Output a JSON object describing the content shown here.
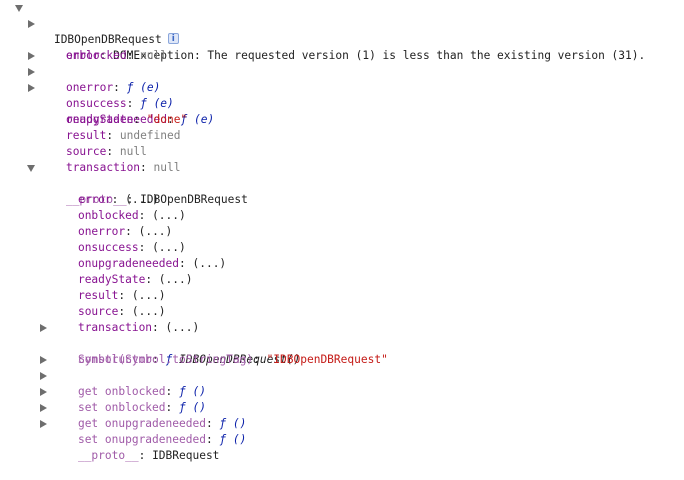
{
  "root": {
    "label": "IDBOpenDBRequest",
    "icon": "info-icon"
  },
  "props": {
    "error": {
      "key": "error",
      "sep": ": ",
      "value": "DOMException: The requested version (1) is less than the existing version (31)."
    },
    "onblocked": {
      "key": "onblocked",
      "sep": ": ",
      "value": "null"
    },
    "onerror": {
      "key": "onerror",
      "sep": ": ",
      "fn": "ƒ",
      "sig": "(e)"
    },
    "onsuccess": {
      "key": "onsuccess",
      "sep": ": ",
      "fn": "ƒ",
      "sig": "(e)"
    },
    "onupgradeneeded": {
      "key": "onupgradeneeded",
      "sep": ": ",
      "fn": "ƒ",
      "sig": "(e)"
    },
    "readyState": {
      "key": "readyState",
      "sep": ": ",
      "value": "\"done\""
    },
    "result": {
      "key": "result",
      "sep": ": ",
      "value": "undefined"
    },
    "source": {
      "key": "source",
      "sep": ": ",
      "value": "null"
    },
    "transaction": {
      "key": "transaction",
      "sep": ": ",
      "value": "null"
    }
  },
  "proto": {
    "key": "__proto__",
    "sep": ": ",
    "value": "IDBOpenDBRequest",
    "accessors": [
      {
        "key": "error",
        "value": "(...)"
      },
      {
        "key": "onblocked",
        "value": "(...)"
      },
      {
        "key": "onerror",
        "value": "(...)"
      },
      {
        "key": "onsuccess",
        "value": "(...)"
      },
      {
        "key": "onupgradeneeded",
        "value": "(...)"
      },
      {
        "key": "readyState",
        "value": "(...)"
      },
      {
        "key": "result",
        "value": "(...)"
      },
      {
        "key": "source",
        "value": "(...)"
      },
      {
        "key": "transaction",
        "value": "(...)"
      }
    ],
    "constructor": {
      "key": "constructor",
      "sep": ": ",
      "fn": "ƒ",
      "name": "IDBOpenDBRequest()"
    },
    "tag": {
      "key": "Symbol(Symbol.toStringTag)",
      "sep": ": ",
      "value": "\"IDBOpenDBRequest\""
    },
    "getters": [
      {
        "key": "get onblocked",
        "fn": "ƒ",
        "sig": "()"
      },
      {
        "key": "set onblocked",
        "fn": "ƒ",
        "sig": "()"
      },
      {
        "key": "get onupgradeneeded",
        "fn": "ƒ",
        "sig": "()"
      },
      {
        "key": "set onupgradeneeded",
        "fn": "ƒ",
        "sig": "()"
      }
    ],
    "inner_proto": {
      "key": "__proto__",
      "sep": ": ",
      "value": "IDBRequest"
    }
  },
  "colors": {
    "key": "#881391",
    "key_dim": "#a05ba8",
    "null": "#808080",
    "string": "#c41a16",
    "function": "#0d22aa",
    "text": "#222222",
    "triangle": "#6e6e6e"
  }
}
